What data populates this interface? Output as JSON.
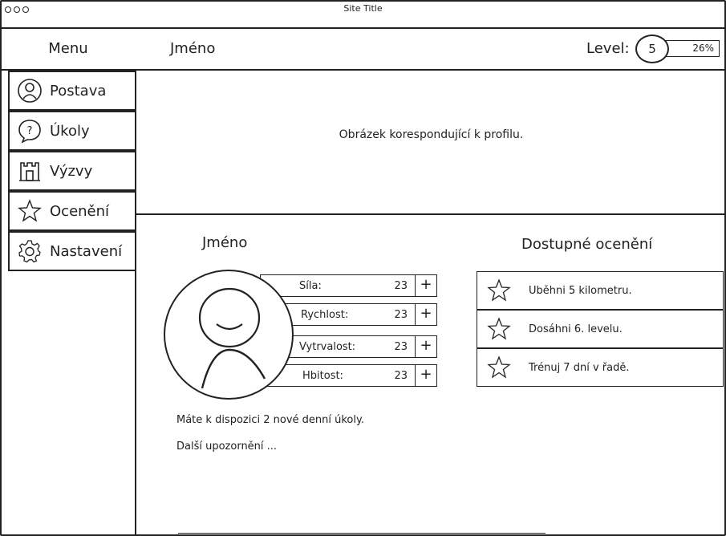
{
  "window": {
    "title": "Site Title"
  },
  "header": {
    "menu_label": "Menu",
    "name": "Jméno",
    "level_label": "Level:",
    "level_value": "5",
    "level_progress": "26%",
    "level_progress_fraction": 0.26
  },
  "sidebar": {
    "items": [
      {
        "label": "Postava",
        "icon": "person-icon"
      },
      {
        "label": "Úkoly",
        "icon": "help-icon"
      },
      {
        "label": "Výzvy",
        "icon": "castle-icon"
      },
      {
        "label": "Ocenění",
        "icon": "star-icon"
      },
      {
        "label": "Nastavení",
        "icon": "gear-icon"
      }
    ]
  },
  "banner": {
    "text": "Obrázek korespondující k profilu."
  },
  "profile": {
    "name": "Jméno",
    "stats": [
      {
        "name": "Síla:",
        "value": "23",
        "action": "+"
      },
      {
        "name": "Rychlost:",
        "value": "23",
        "action": "+"
      },
      {
        "name": "Vytrvalost:",
        "value": "23",
        "action": "+"
      },
      {
        "name": "Hbitost:",
        "value": "23",
        "action": "+"
      }
    ],
    "notices": [
      "Máte k dispozici 2 nové denní úkoly.",
      "Další upozornění ..."
    ]
  },
  "awards": {
    "title": "Dostupné ocenění",
    "items": [
      {
        "label": "Uběhni 5 kilometru.",
        "icon": "star-icon"
      },
      {
        "label": "Dosáhni 6. levelu.",
        "icon": "star-icon"
      },
      {
        "label": "Trénuj 7 dní v řadě.",
        "icon": "star-icon"
      }
    ]
  }
}
